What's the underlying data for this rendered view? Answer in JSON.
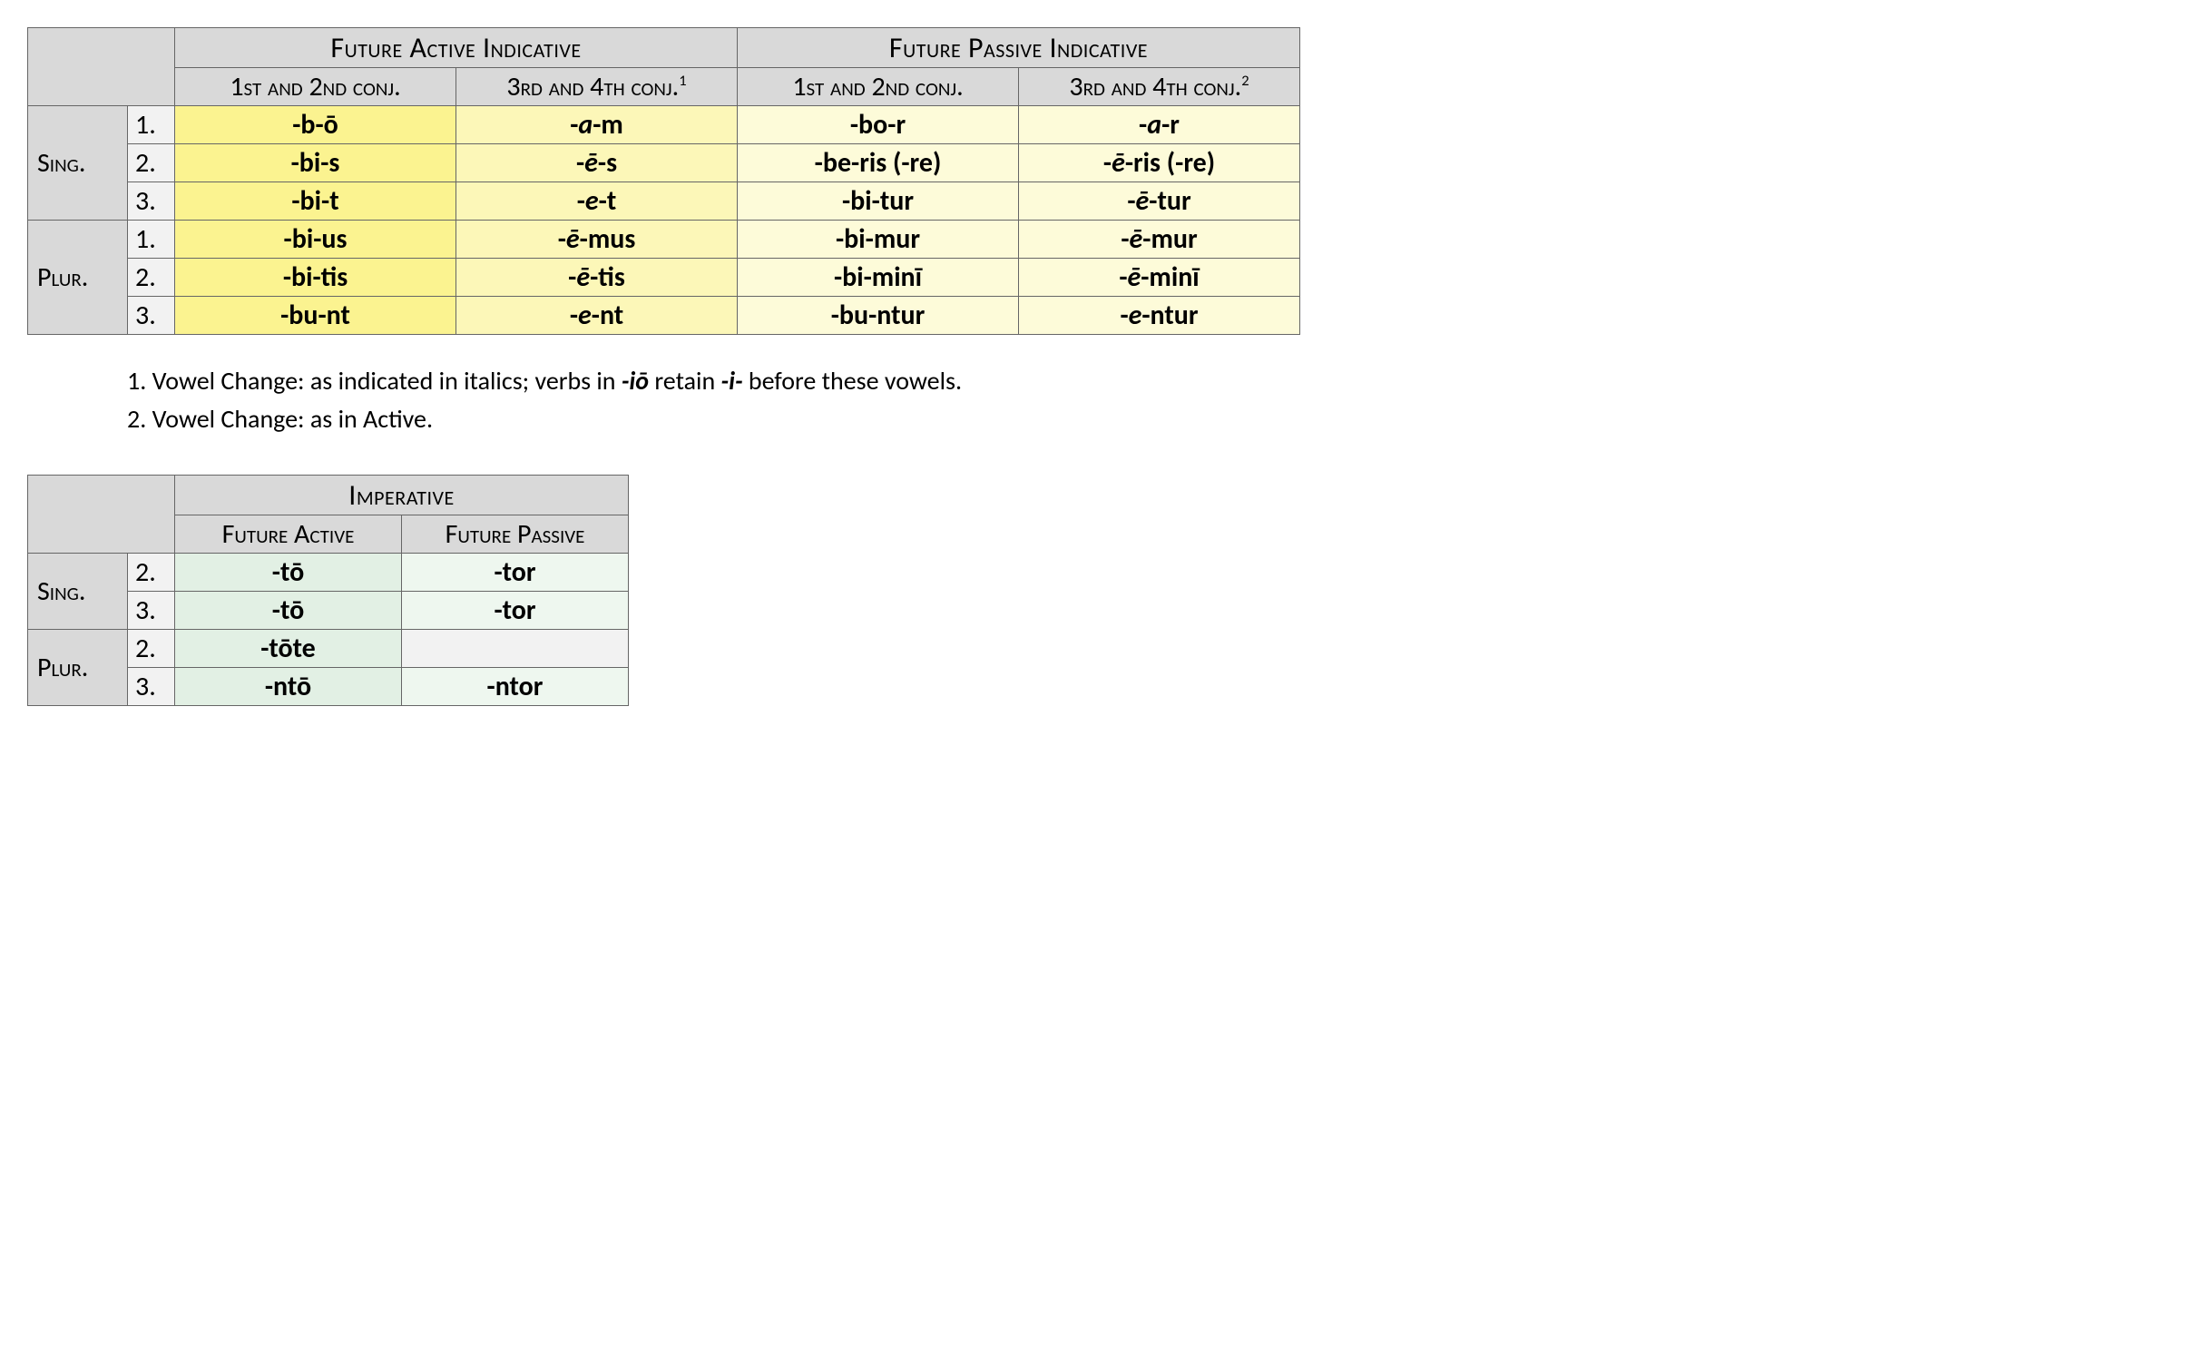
{
  "table1": {
    "mainHeaders": {
      "active": "Future Active Indicative",
      "passive": "Future Passive Indicative"
    },
    "subHeaders": {
      "c12": "1st and 2nd conj.",
      "c34a": "3rd and 4th conj.",
      "sup1": "1",
      "c12p": "1st and 2nd conj.",
      "c34p": "3rd and 4th conj.",
      "sup2": "2"
    },
    "sideSing": "Sing.",
    "sidePlur": "Plur.",
    "rows": {
      "s1": {
        "n": "1.",
        "a12": "-b-ō",
        "a34_pre": "-",
        "a34_it": "a",
        "a34_post": "-m",
        "p12": "-bo-r",
        "p34_pre": "-",
        "p34_it": "a",
        "p34_post": "-r"
      },
      "s2": {
        "n": "2.",
        "a12": "-bi-s",
        "a34_pre": "-",
        "a34_it": "ē",
        "a34_post": "-s",
        "p12": "-be-ris (-re)",
        "p34_pre": "-",
        "p34_it": "ē",
        "p34_post": "-ris (-re)"
      },
      "s3": {
        "n": "3.",
        "a12": "-bi-t",
        "a34_pre": "-",
        "a34_it": "e",
        "a34_post": "-t",
        "p12": "-bi-tur",
        "p34_pre": "-",
        "p34_it": "ē",
        "p34_post": "-tur"
      },
      "p1": {
        "n": "1.",
        "a12": "-bi-us",
        "a34_pre": "-",
        "a34_it": "ē",
        "a34_post": "-mus",
        "p12": "-bi-mur",
        "p34_pre": "-",
        "p34_it": "ē",
        "p34_post": "-mur"
      },
      "p2": {
        "n": "2.",
        "a12": "-bi-tis",
        "a34_pre": "-",
        "a34_it": "ē",
        "a34_post": "-tis",
        "p12": "-bi-minī",
        "p34_pre": "-",
        "p34_it": "ē",
        "p34_post": "-minī"
      },
      "p3": {
        "n": "3.",
        "a12": "-bu-nt",
        "a34_pre": "-",
        "a34_it": "e",
        "a34_post": "-nt",
        "p12": "-bu-ntur",
        "p34_pre": "-",
        "p34_it": "e",
        "p34_post": "-ntur"
      }
    }
  },
  "notes": {
    "n1_a": "1. Vowel Change: as indicated in italics; verbs in ",
    "n1_b": "-iō",
    "n1_c": " retain ",
    "n1_d": "-i-",
    "n1_e": " before these vowels.",
    "n2": "2. Vowel Change: as in Active."
  },
  "table2": {
    "main": "Imperative",
    "colA": "Future Active",
    "colB": "Future Passive",
    "sideSing": "Sing.",
    "sidePlur": "Plur.",
    "rows": {
      "s2": {
        "n": "2.",
        "a": "-tō",
        "p": "-tor"
      },
      "s3": {
        "n": "3.",
        "a": "-tō",
        "p": "-tor"
      },
      "p2": {
        "n": "2.",
        "a": "-tōte",
        "p": ""
      },
      "p3": {
        "n": "3.",
        "a": "-ntō",
        "p": "-ntor"
      }
    }
  }
}
